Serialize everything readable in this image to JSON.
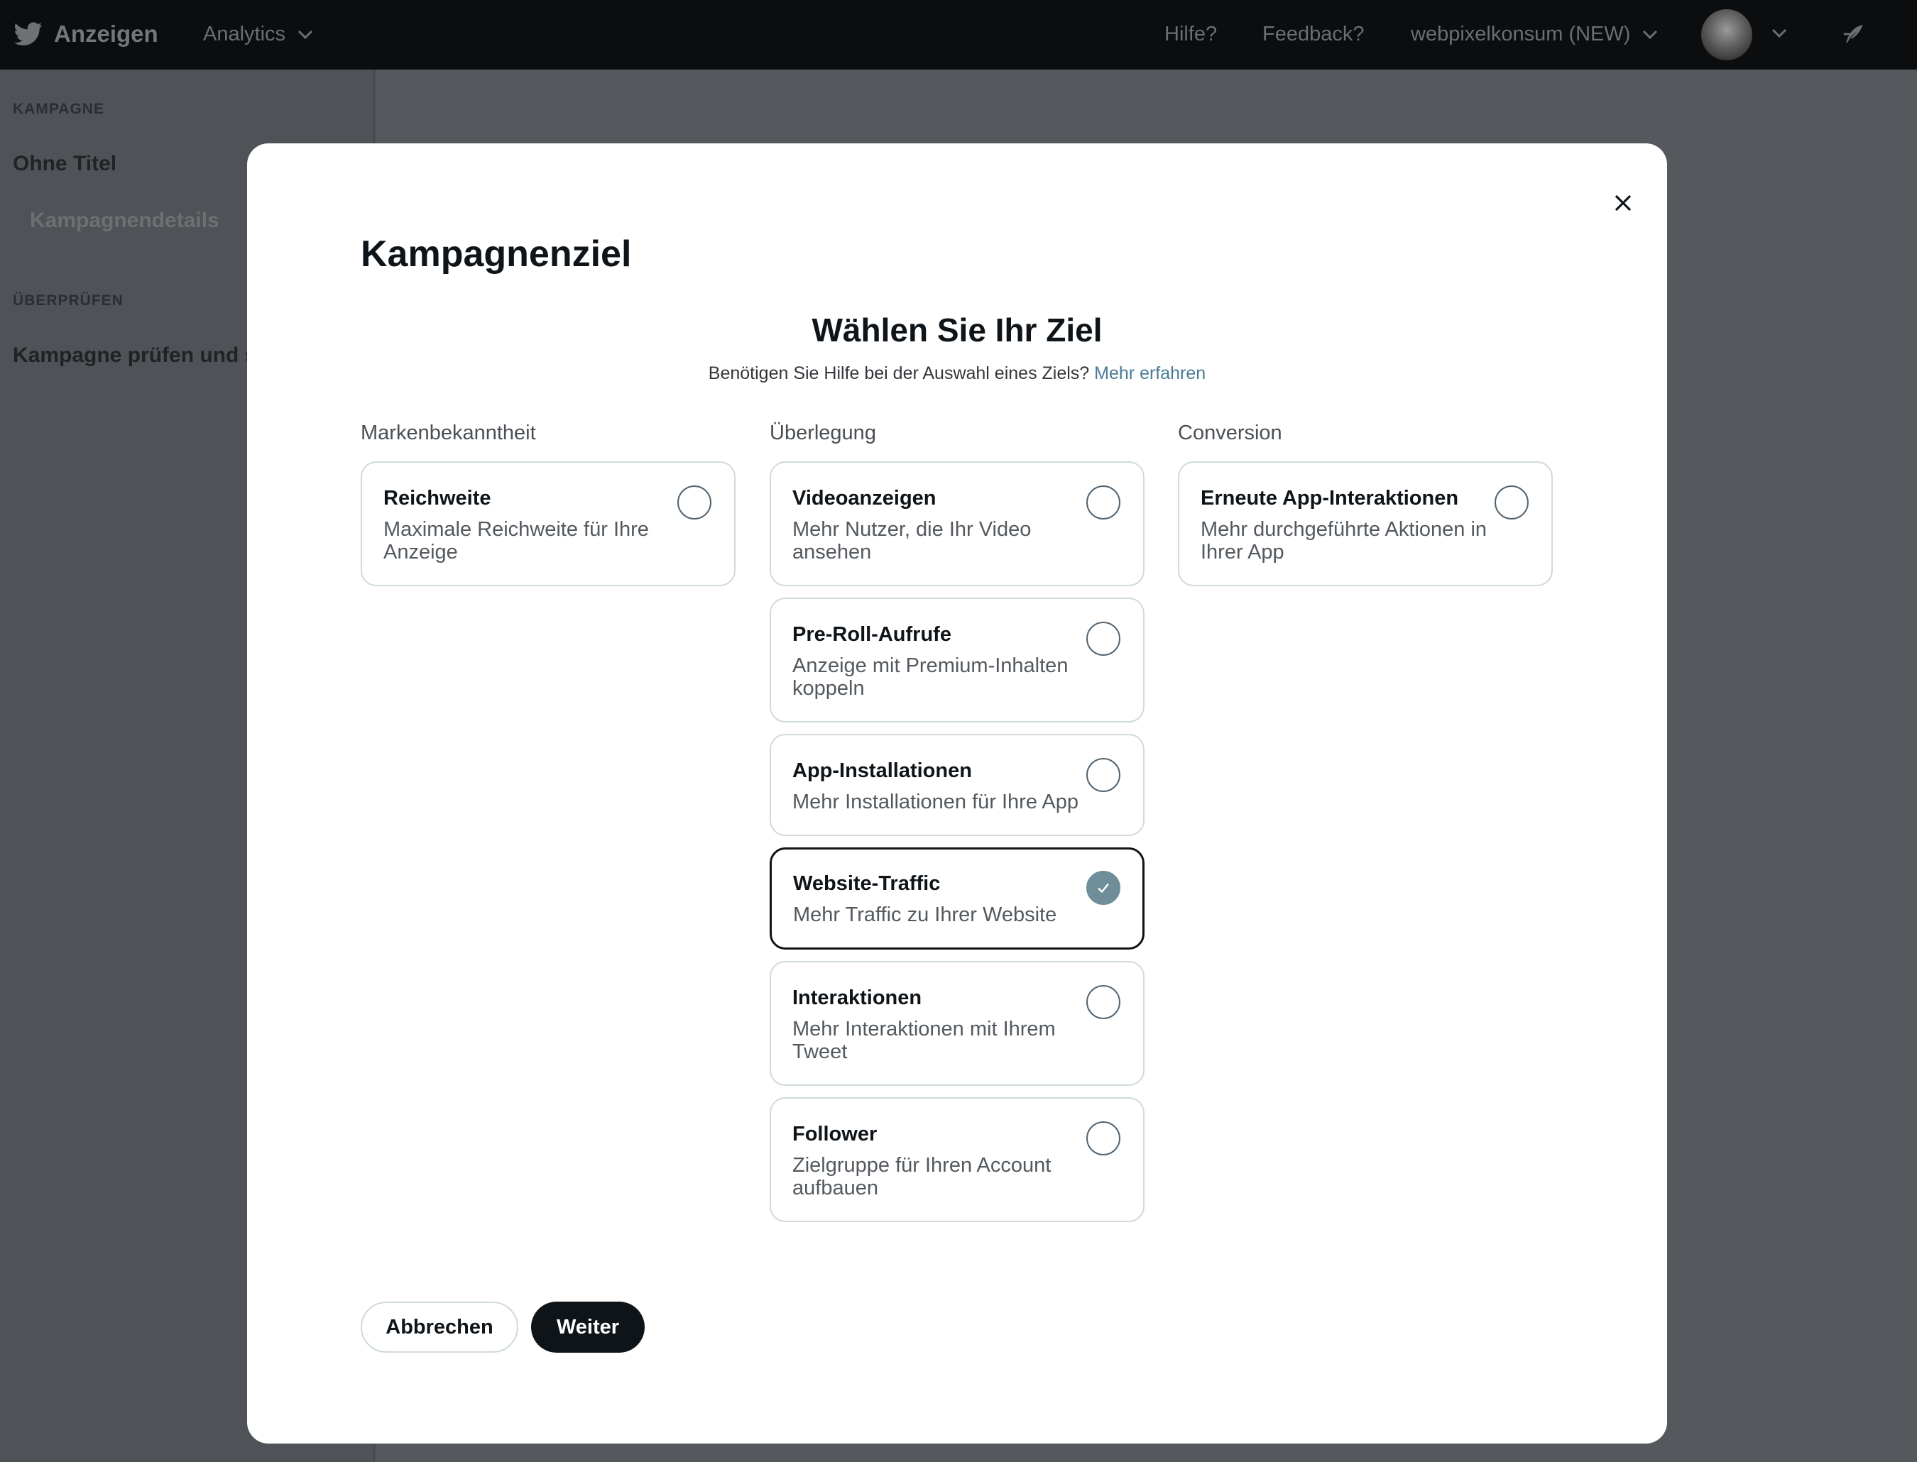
{
  "topbar": {
    "brand": "Anzeigen",
    "analytics_label": "Analytics",
    "help_label": "Hilfe?",
    "feedback_label": "Feedback?",
    "account_name": "webpixelkonsum (NEW)"
  },
  "sidebar": {
    "section_campaign": "KAMPAGNE",
    "campaign_title": "Ohne Titel",
    "campaign_details": "Kampagnendetails",
    "section_review": "ÜBERPRÜFEN",
    "review_item": "Kampagne prüfen und s"
  },
  "modal": {
    "title": "Kampagnenziel",
    "heading": "Wählen Sie Ihr Ziel",
    "help_text": "Benötigen Sie Hilfe bei der Auswahl eines Ziels?",
    "help_link": "Mehr erfahren",
    "columns": [
      {
        "label": "Markenbekanntheit",
        "options": [
          {
            "title": "Reichweite",
            "desc": "Maximale Reichweite für Ihre Anzeige"
          }
        ]
      },
      {
        "label": "Überlegung",
        "options": [
          {
            "title": "Videoanzeigen",
            "desc": "Mehr Nutzer, die Ihr Video ansehen"
          },
          {
            "title": "Pre-Roll-Aufrufe",
            "desc": "Anzeige mit Premium-Inhalten koppeln"
          },
          {
            "title": "App-Installationen",
            "desc": "Mehr Installationen für Ihre App"
          },
          {
            "title": "Website-Traffic",
            "desc": "Mehr Traffic zu Ihrer Website"
          },
          {
            "title": "Interaktionen",
            "desc": "Mehr Interaktionen mit Ihrem Tweet"
          },
          {
            "title": "Follower",
            "desc": "Zielgruppe für Ihren Account aufbauen"
          }
        ]
      },
      {
        "label": "Conversion",
        "options": [
          {
            "title": "Erneute App-Interaktionen",
            "desc": "Mehr durchgeführte Aktionen in Ihrer App"
          }
        ]
      }
    ],
    "selected_option": "Website-Traffic",
    "cancel_label": "Abbrechen",
    "next_label": "Weiter"
  },
  "colors": {
    "selected_radio": "#6f8e99",
    "primary_button": "#0f1419",
    "link": "#4a7c94",
    "overlay": "#4f5357"
  }
}
